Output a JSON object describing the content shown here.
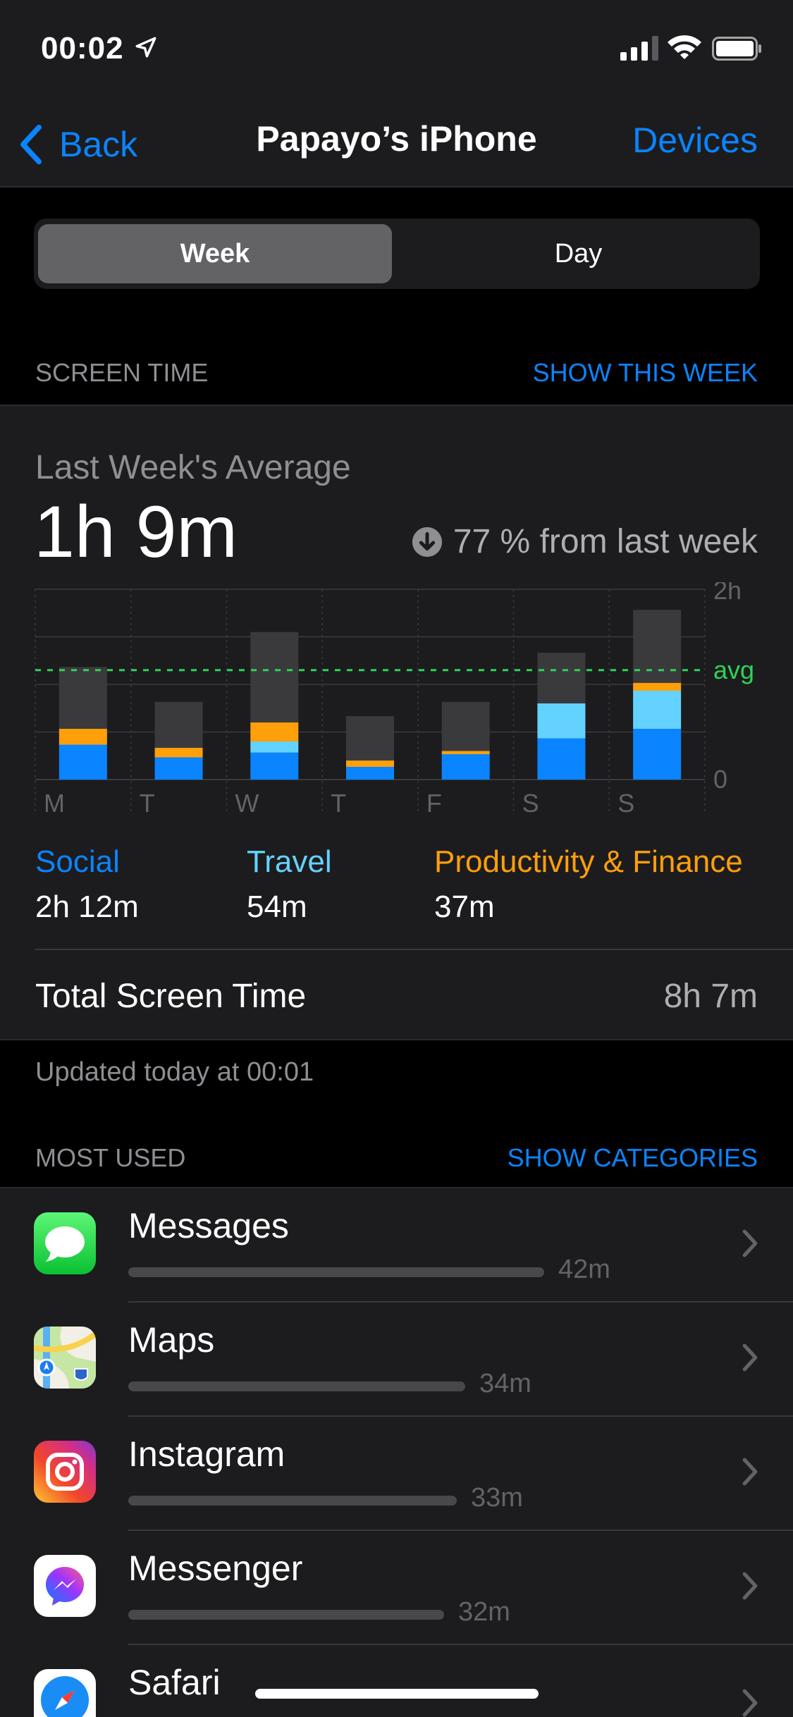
{
  "status_bar": {
    "time": "00:02"
  },
  "nav": {
    "back_label": "Back",
    "title": "Papayo’s iPhone",
    "right_label": "Devices"
  },
  "segmented": {
    "week": "Week",
    "day": "Day",
    "selected": "Week"
  },
  "screen_time_header": {
    "title": "SCREEN TIME",
    "link": "SHOW THIS WEEK"
  },
  "summary": {
    "average_label": "Last Week's Average",
    "average_value": "1h 9m",
    "change_text": "77 % from last week"
  },
  "colors": {
    "social": "#0a84ff",
    "travel": "#64d2ff",
    "productivity": "#ff9f0a",
    "other": "#3a3a3c",
    "avg_line": "#30d158"
  },
  "chart_data": {
    "type": "bar",
    "stacked": true,
    "categories": [
      "M",
      "T",
      "W",
      "T",
      "F",
      "S",
      "S"
    ],
    "y_tick_labels": [
      "2h",
      "avg",
      "0"
    ],
    "ylim_minutes": [
      0,
      120
    ],
    "average_minutes": 69,
    "series": [
      {
        "name": "Social",
        "values": [
          22,
          14,
          17,
          8,
          16,
          26,
          32
        ]
      },
      {
        "name": "Travel",
        "values": [
          0,
          0,
          7,
          0,
          0,
          22,
          24
        ]
      },
      {
        "name": "Productivity & Finance",
        "values": [
          10,
          6,
          12,
          4,
          2,
          0,
          5
        ]
      },
      {
        "values": [
          39,
          29,
          57,
          28,
          31,
          32,
          46
        ]
      }
    ],
    "grid": true
  },
  "legend": [
    {
      "label": "Social",
      "value": "2h 12m"
    },
    {
      "label": "Travel",
      "value": "54m"
    },
    {
      "label": "Productivity & Finance",
      "value": "37m"
    }
  ],
  "total": {
    "label": "Total Screen Time",
    "value": "8h 7m"
  },
  "updated_text": "Updated today at 00:01",
  "most_used_header": {
    "title": "MOST USED",
    "link": "SHOW CATEGORIES"
  },
  "apps": [
    {
      "name": "Messages",
      "time": "42m",
      "fraction": 1.0,
      "icon": "messages-icon"
    },
    {
      "name": "Maps",
      "time": "34m",
      "fraction": 0.81,
      "icon": "maps-icon"
    },
    {
      "name": "Instagram",
      "time": "33m",
      "fraction": 0.79,
      "icon": "instagram-icon"
    },
    {
      "name": "Messenger",
      "time": "32m",
      "fraction": 0.76,
      "icon": "messenger-icon"
    },
    {
      "name": "Safari",
      "time": "",
      "fraction": 0,
      "icon": "safari-icon"
    }
  ]
}
